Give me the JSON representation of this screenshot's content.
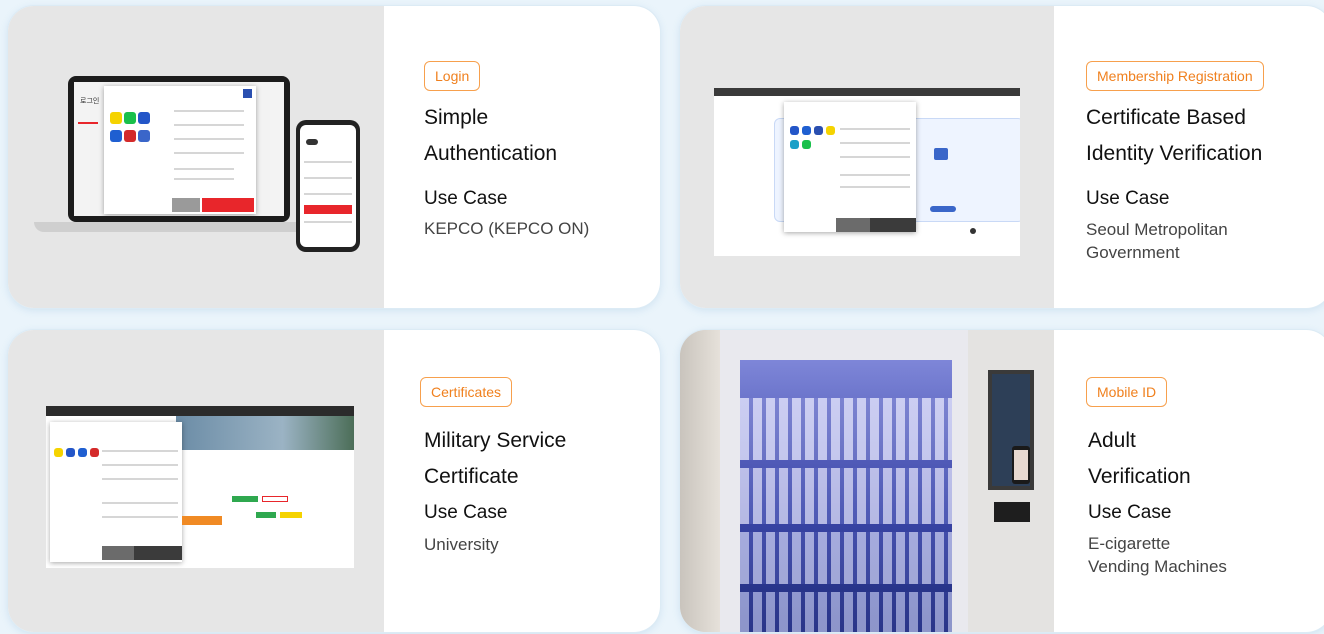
{
  "cards": [
    {
      "tag": "Login",
      "title_lines": [
        "Simple",
        "Authentication"
      ],
      "use_case_label": "Use Case",
      "use_case_lines": [
        "KEPCO (KEPCO ON)"
      ]
    },
    {
      "tag": "Membership Registration",
      "title_lines": [
        "Certificate Based",
        "Identity Verification"
      ],
      "use_case_label": "Use Case",
      "use_case_lines": [
        "Seoul Metropolitan",
        "Government"
      ]
    },
    {
      "tag": "Certificates",
      "title_lines": [
        "Military Service",
        "Certificate"
      ],
      "use_case_label": "Use Case",
      "use_case_lines": [
        "University"
      ]
    },
    {
      "tag": "Mobile ID",
      "title_lines": [
        "Adult",
        "Verification"
      ],
      "use_case_label": "Use Case",
      "use_case_lines": [
        "E-cigarette",
        "Vending Machines"
      ]
    }
  ],
  "colors": {
    "tag_orange": "#f0801e",
    "accent_red": "#e8262b",
    "panel_grey": "#e6e6e6",
    "page_bg": "#eaf4fb"
  },
  "mock_text": {
    "laptop_header": "로그인"
  }
}
